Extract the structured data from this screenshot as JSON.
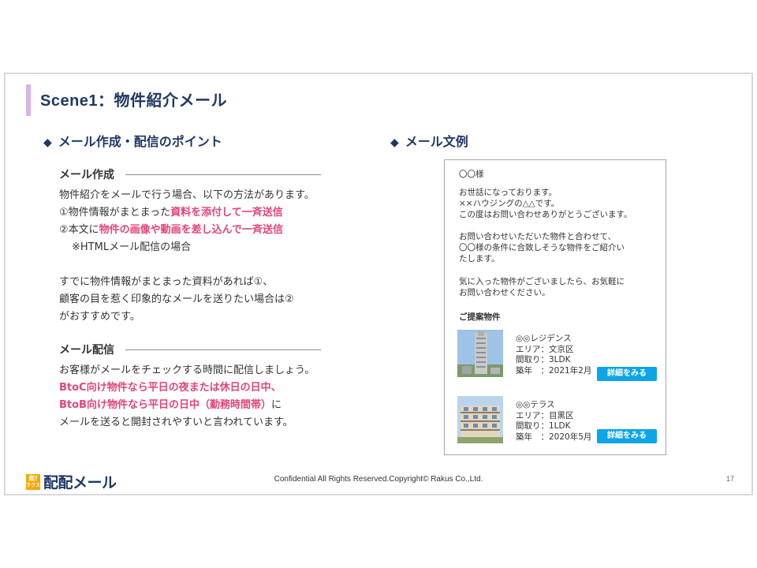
{
  "slide": {
    "title": "Scene1：物件紹介メール",
    "left_heading": "メール作成・配信のポイント",
    "right_heading": "メール文例",
    "diamond": "◆",
    "sections": {
      "create": {
        "heading": "メール作成",
        "line1": "物件紹介をメールで行う場合、以下の方法があります。",
        "line2_a": "①物件情報がまとまった",
        "line2_b": "資料を添付して一斉送信",
        "line3_a": "②本文に",
        "line3_b": "物件の画像や動画を差し込んで一斉送信",
        "line4": "※HTMLメール配信の場合",
        "line5": "すでに物件情報がまとまった資料があれば①、",
        "line6": "顧客の目を惹く印象的なメールを送りたい場合は②",
        "line7": "がおすすめです。"
      },
      "deliver": {
        "heading": "メール配信",
        "line1": "お客様がメールをチェックする時間に配信しましょう。",
        "line2": "BtoC向け物件なら平日の夜または休日の日中、",
        "line3_a": "BtoB向け物件なら平日の日中（勤務時間帯）",
        "line3_b": "に",
        "line4": "メールを送ると開封されやすいと言われています。"
      }
    }
  },
  "mail": {
    "salutation": "〇〇様",
    "p1": [
      "お世話になっております。",
      "××ハウジングの△△です。",
      "この度はお問い合わせありがとうございます。"
    ],
    "p2": [
      "お問い合わせいただいた物件と合わせて、",
      "〇〇様の条件に合致しそうな物件をご紹介い",
      "たします。"
    ],
    "p3": [
      "気に入った物件がございましたら、お気軽に",
      "お問い合わせください。"
    ],
    "proposal_heading": "ご提案物件",
    "properties": [
      {
        "name": "◎◎レジデンス",
        "area": "エリア：文京区",
        "layout": "間取り：3LDK",
        "built": "築年　：2021年2月",
        "button": "詳細をみる"
      },
      {
        "name": "◎◎テラス",
        "area": "エリア：目黒区",
        "layout": "間取り：1LDK",
        "built": "築年　：2020年5月",
        "button": "詳細をみる"
      }
    ]
  },
  "footer": {
    "logo_top": "楽!",
    "logo_bottom": "ラクス",
    "logo_text": "配配メール",
    "copyright": "Confidential All Rights Reserved.Copyright© Rakus Co.,Ltd.",
    "page": "17"
  },
  "colors": {
    "accent": "#e4447a",
    "navy": "#1f3864",
    "button": "#0ea4e8",
    "title_bar": "#d9b3e6"
  }
}
